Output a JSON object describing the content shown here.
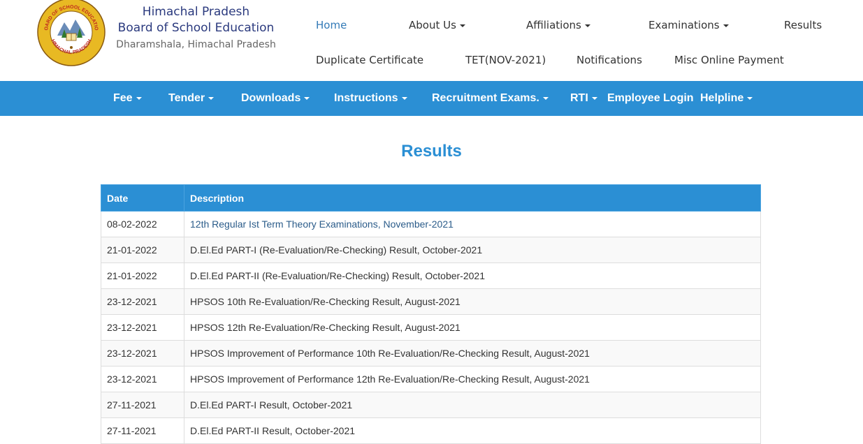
{
  "header": {
    "org_line1": "Himachal Pradesh",
    "org_line2": "Board of School Education",
    "org_line3": "Dharamshala, Himachal Pradesh",
    "logo_text_top": "BOARD OF SCHOOL EDUCATION",
    "logo_text_bottom": "HIMACHAL PRADESH"
  },
  "topnav": {
    "home": "Home",
    "about": "About Us",
    "affiliations": "Affiliations",
    "examinations": "Examinations",
    "results": "Results",
    "duplicate": "Duplicate Certificate",
    "tet": "TET(NOV-2021)",
    "notifications": "Notifications",
    "misc": "Misc Online Payment"
  },
  "bluenav": {
    "fee": "Fee",
    "tender": "Tender",
    "downloads": "Downloads",
    "instructions": "Instructions",
    "recruitment": "Recruitment Exams.",
    "rti": "RTI",
    "employee": "Employee Login",
    "helpline": "Helpline"
  },
  "page_title": "Results",
  "table": {
    "headers": [
      "Date",
      "Description"
    ],
    "rows": [
      {
        "date": "08-02-2022",
        "desc": "12th Regular Ist Term Theory Examinations, November-2021"
      },
      {
        "date": "21-01-2022",
        "desc": "D.El.Ed PART-I (Re-Evaluation/Re-Checking) Result, October-2021"
      },
      {
        "date": "21-01-2022",
        "desc": "D.El.Ed PART-II (Re-Evaluation/Re-Checking) Result, October-2021"
      },
      {
        "date": "23-12-2021",
        "desc": "HPSOS 10th Re-Evaluation/Re-Checking Result, August-2021"
      },
      {
        "date": "23-12-2021",
        "desc": "HPSOS 12th Re-Evaluation/Re-Checking Result, August-2021"
      },
      {
        "date": "23-12-2021",
        "desc": "HPSOS Improvement of Performance 10th Re-Evaluation/Re-Checking Result, August-2021"
      },
      {
        "date": "23-12-2021",
        "desc": "HPSOS Improvement of Performance 12th Re-Evaluation/Re-Checking Result, August-2021"
      },
      {
        "date": "27-11-2021",
        "desc": "D.El.Ed PART-I Result, October-2021"
      },
      {
        "date": "27-11-2021",
        "desc": "D.El.Ed PART-II Result, October-2021"
      }
    ]
  },
  "colors": {
    "accent": "#2b8fd4",
    "org_text": "#2b3a7e",
    "link": "#2b5c8a"
  }
}
